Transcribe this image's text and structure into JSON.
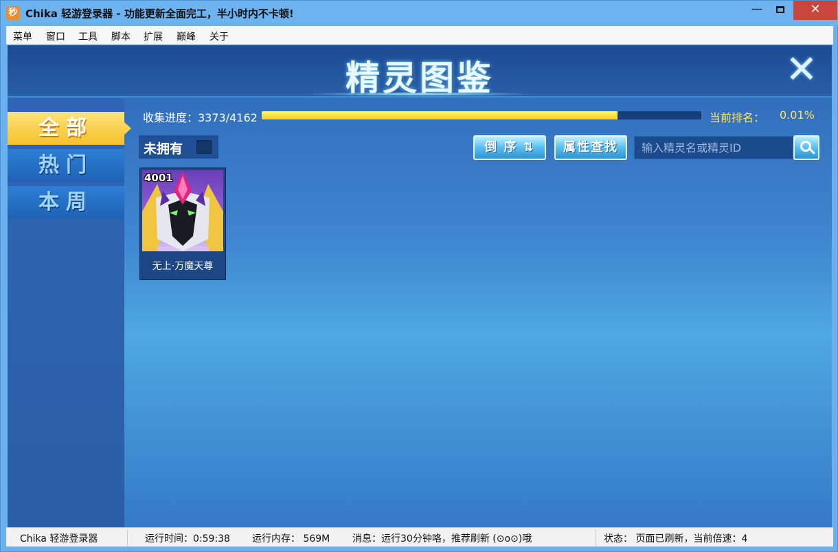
{
  "window": {
    "logo_text": "秒",
    "title": "Chika 轻游登录器 - 功能更新全面完工，半小时内不卡顿!",
    "min_glyph": "—",
    "close_glyph": "✕"
  },
  "menu": [
    "菜单",
    "窗口",
    "工具",
    "脚本",
    "扩展",
    "巅峰",
    "关于"
  ],
  "game": {
    "title": "精灵图鉴",
    "close_glyph": "✕",
    "tabs": [
      {
        "label": "全部",
        "active": true
      },
      {
        "label": "热门",
        "active": false
      },
      {
        "label": "本周",
        "active": false
      }
    ],
    "progress": {
      "label": "收集进度：3373/4162",
      "collected": 3373,
      "total": 4162,
      "fraction": 0.81
    },
    "rank": {
      "label": "当前排名：",
      "value": "0.01%"
    },
    "unowned_label": "未拥有",
    "sort_button": "倒 序 ⇅",
    "attr_button": "属性查找",
    "search_placeholder": "输入精灵名或精灵ID",
    "cards": [
      {
        "id": "4001",
        "name": "无上·万魔天尊"
      }
    ]
  },
  "status": {
    "app": "Chika 轻游登录器",
    "runtime": "运行时间：0:59:38",
    "memory": "运行内存： 569M",
    "message": "消息：运行30分钟咯，推荐刷新 (⊙o⊙)哦",
    "state": "状态：  页面已刷新，当前倍速：4"
  },
  "colors": {
    "accent_gold": "#f4c128",
    "rank_yellow": "#ffe55a",
    "close_red": "#c9463d"
  }
}
